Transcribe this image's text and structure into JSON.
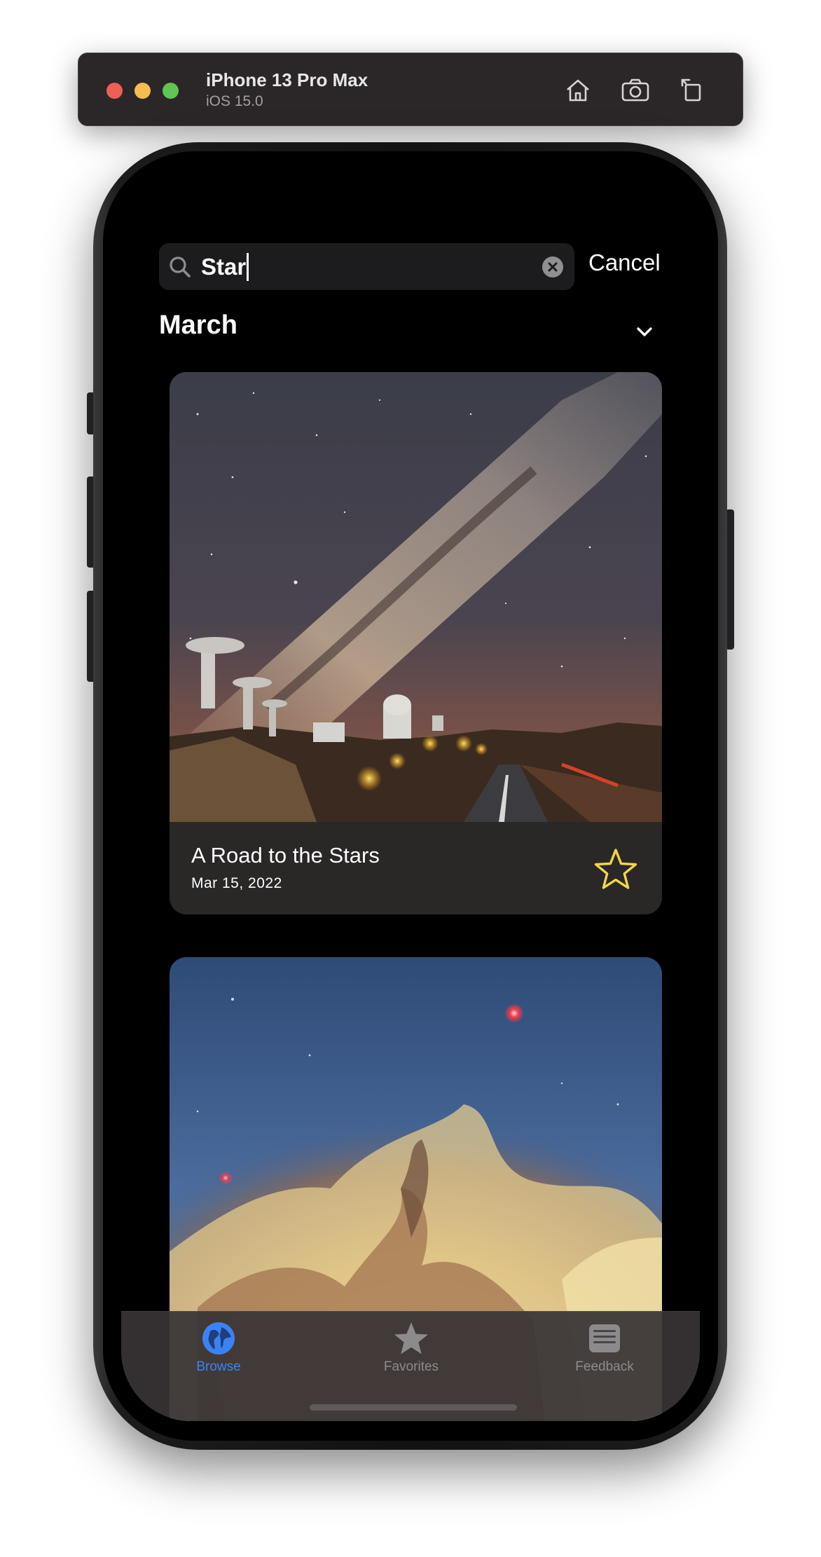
{
  "simulator": {
    "device_name": "iPhone 13 Pro Max",
    "os_version": "iOS 15.0",
    "toolbar_icons": [
      "home-icon",
      "screenshot-icon",
      "rotate-icon"
    ]
  },
  "search": {
    "value": "Star",
    "cancel_label": "Cancel"
  },
  "section": {
    "title": "March",
    "expanded": true
  },
  "cards": [
    {
      "title": "A Road to the Stars",
      "date": "Mar 15, 2022",
      "favorite": true,
      "image": "milky-way-observatory-road"
    },
    {
      "title": "",
      "date": "",
      "image": "nebula-clouds"
    }
  ],
  "tabbar": {
    "items": [
      {
        "label": "Browse",
        "icon": "globe-icon",
        "selected": true
      },
      {
        "label": "Favorites",
        "icon": "star-icon",
        "selected": false
      },
      {
        "label": "Feedback",
        "icon": "feedback-icon",
        "selected": false
      }
    ]
  },
  "colors": {
    "accent": "#3b82f6",
    "favorite_star": "#f5d547",
    "background": "#000000",
    "card": "#2a2727"
  }
}
